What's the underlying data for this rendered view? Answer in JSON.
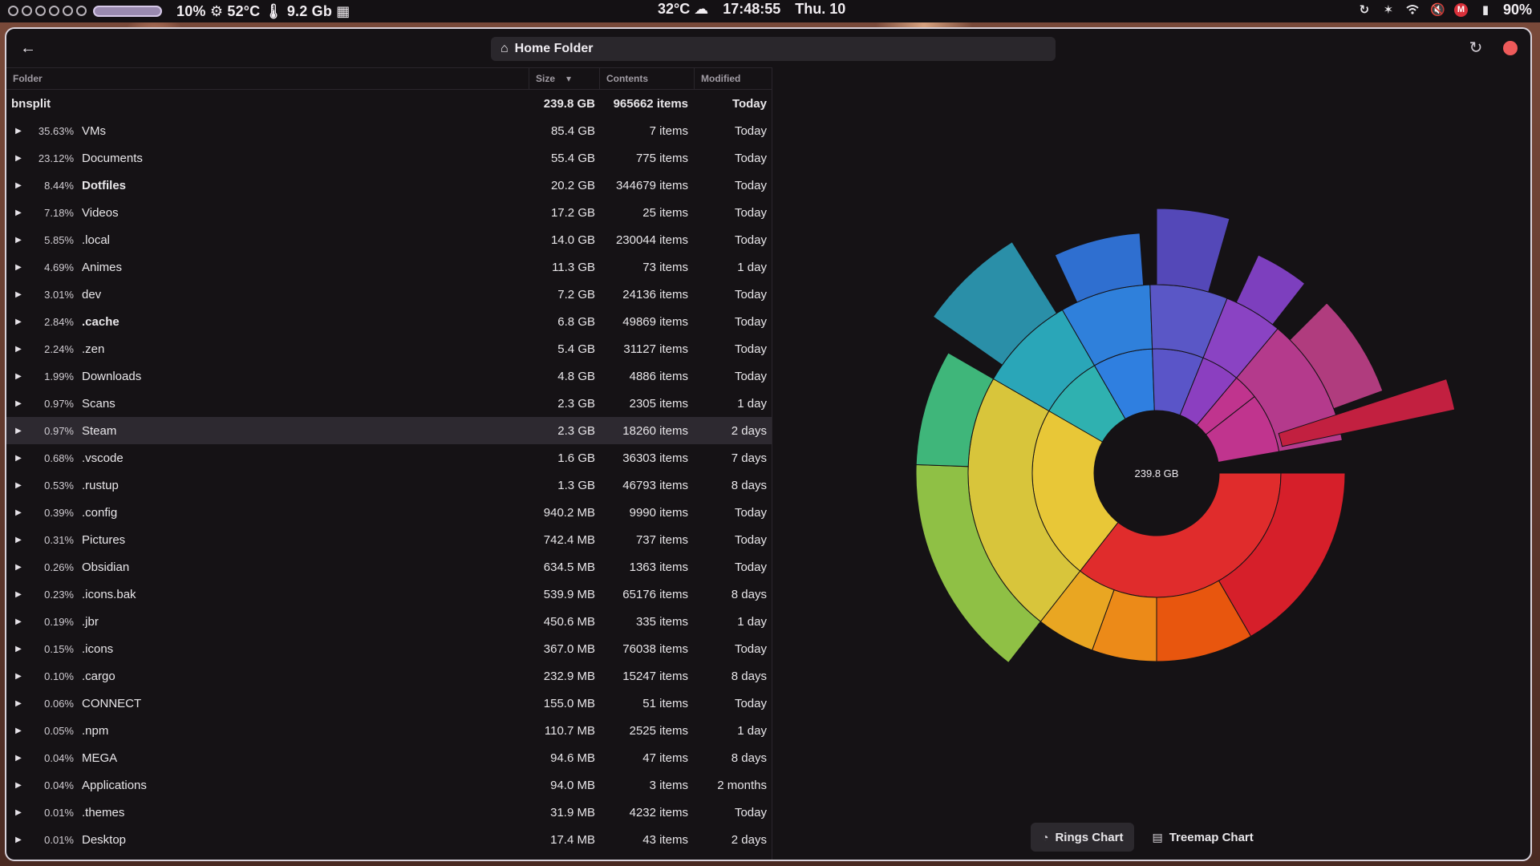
{
  "topbar": {
    "stats": "10% ⚙ 52°C 🌡 9.2 Gb ▦",
    "weather": "32°C ☁",
    "clock": "17:48:55",
    "date": "Thu. 10",
    "battery": "90%",
    "icons": [
      "sync-icon",
      "bluetooth-icon",
      "wifi-icon",
      "mute-icon",
      "mail-icon",
      "battery-icon"
    ]
  },
  "header": {
    "back_glyph": "←",
    "path_icon": "⌂",
    "path_label": "Home Folder",
    "refresh_glyph": "↻"
  },
  "columns": {
    "folder": "Folder",
    "size": "Size",
    "contents": "Contents",
    "modified": "Modified",
    "sort_glyph": "▾"
  },
  "root": {
    "name": "bnsplit",
    "size": "239.8 GB",
    "contents": "965662 items",
    "modified": "Today"
  },
  "rows": [
    {
      "pct": "35.63%",
      "name": "VMs",
      "size": "85.4 GB",
      "contents": "7 items",
      "modified": "Today",
      "bold": false
    },
    {
      "pct": "23.12%",
      "name": "Documents",
      "size": "55.4 GB",
      "contents": "775 items",
      "modified": "Today",
      "bold": false
    },
    {
      "pct": "8.44%",
      "name": "Dotfiles",
      "size": "20.2 GB",
      "contents": "344679 items",
      "modified": "Today",
      "bold": true
    },
    {
      "pct": "7.18%",
      "name": "Videos",
      "size": "17.2 GB",
      "contents": "25 items",
      "modified": "Today",
      "bold": false
    },
    {
      "pct": "5.85%",
      "name": ".local",
      "size": "14.0 GB",
      "contents": "230044 items",
      "modified": "Today",
      "bold": false
    },
    {
      "pct": "4.69%",
      "name": "Animes",
      "size": "11.3 GB",
      "contents": "73 items",
      "modified": "1 day",
      "bold": false
    },
    {
      "pct": "3.01%",
      "name": "dev",
      "size": "7.2 GB",
      "contents": "24136 items",
      "modified": "Today",
      "bold": false
    },
    {
      "pct": "2.84%",
      "name": ".cache",
      "size": "6.8 GB",
      "contents": "49869 items",
      "modified": "Today",
      "bold": true
    },
    {
      "pct": "2.24%",
      "name": ".zen",
      "size": "5.4 GB",
      "contents": "31127 items",
      "modified": "Today",
      "bold": false
    },
    {
      "pct": "1.99%",
      "name": "Downloads",
      "size": "4.8 GB",
      "contents": "4886 items",
      "modified": "Today",
      "bold": false
    },
    {
      "pct": "0.97%",
      "name": "Scans",
      "size": "2.3 GB",
      "contents": "2305 items",
      "modified": "1 day",
      "bold": false
    },
    {
      "pct": "0.97%",
      "name": "Steam",
      "size": "2.3 GB",
      "contents": "18260 items",
      "modified": "2 days",
      "bold": false
    },
    {
      "pct": "0.68%",
      "name": ".vscode",
      "size": "1.6 GB",
      "contents": "36303 items",
      "modified": "7 days",
      "bold": false
    },
    {
      "pct": "0.53%",
      "name": ".rustup",
      "size": "1.3 GB",
      "contents": "46793 items",
      "modified": "8 days",
      "bold": false
    },
    {
      "pct": "0.39%",
      "name": ".config",
      "size": "940.2 MB",
      "contents": "9990 items",
      "modified": "Today",
      "bold": false
    },
    {
      "pct": "0.31%",
      "name": "Pictures",
      "size": "742.4 MB",
      "contents": "737 items",
      "modified": "Today",
      "bold": false
    },
    {
      "pct": "0.26%",
      "name": "Obsidian",
      "size": "634.5 MB",
      "contents": "1363 items",
      "modified": "Today",
      "bold": false
    },
    {
      "pct": "0.23%",
      "name": ".icons.bak",
      "size": "539.9 MB",
      "contents": "65176 items",
      "modified": "8 days",
      "bold": false
    },
    {
      "pct": "0.19%",
      "name": ".jbr",
      "size": "450.6 MB",
      "contents": "335 items",
      "modified": "1 day",
      "bold": false
    },
    {
      "pct": "0.15%",
      "name": ".icons",
      "size": "367.0 MB",
      "contents": "76038 items",
      "modified": "Today",
      "bold": false
    },
    {
      "pct": "0.10%",
      "name": ".cargo",
      "size": "232.9 MB",
      "contents": "15247 items",
      "modified": "8 days",
      "bold": false
    },
    {
      "pct": "0.06%",
      "name": "CONNECT",
      "size": "155.0 MB",
      "contents": "51 items",
      "modified": "Today",
      "bold": false
    },
    {
      "pct": "0.05%",
      "name": ".npm",
      "size": "110.7 MB",
      "contents": "2525 items",
      "modified": "1 day",
      "bold": false
    },
    {
      "pct": "0.04%",
      "name": "MEGA",
      "size": "94.6 MB",
      "contents": "47 items",
      "modified": "8 days",
      "bold": false
    },
    {
      "pct": "0.04%",
      "name": "Applications",
      "size": "94.0 MB",
      "contents": "3 items",
      "modified": "2 months",
      "bold": false
    },
    {
      "pct": "0.01%",
      "name": ".themes",
      "size": "31.9 MB",
      "contents": "4232 items",
      "modified": "Today",
      "bold": false
    },
    {
      "pct": "0.01%",
      "name": "Desktop",
      "size": "17.4 MB",
      "contents": "43 items",
      "modified": "2 days",
      "bold": false
    }
  ],
  "selected_row": "Steam",
  "chart": {
    "center_label": "239.8 GB",
    "colors": [
      "#e02c2c",
      "#e8c737",
      "#2fb1b0",
      "#2f7fe0",
      "#5a55c8",
      "#8b3fc0",
      "#c0348e",
      "#c02040"
    ]
  },
  "view_switcher": {
    "rings_label": "Rings Chart",
    "treemap_label": "Treemap Chart",
    "rings_icon": "◔",
    "treemap_icon": "▤",
    "active": "rings"
  }
}
